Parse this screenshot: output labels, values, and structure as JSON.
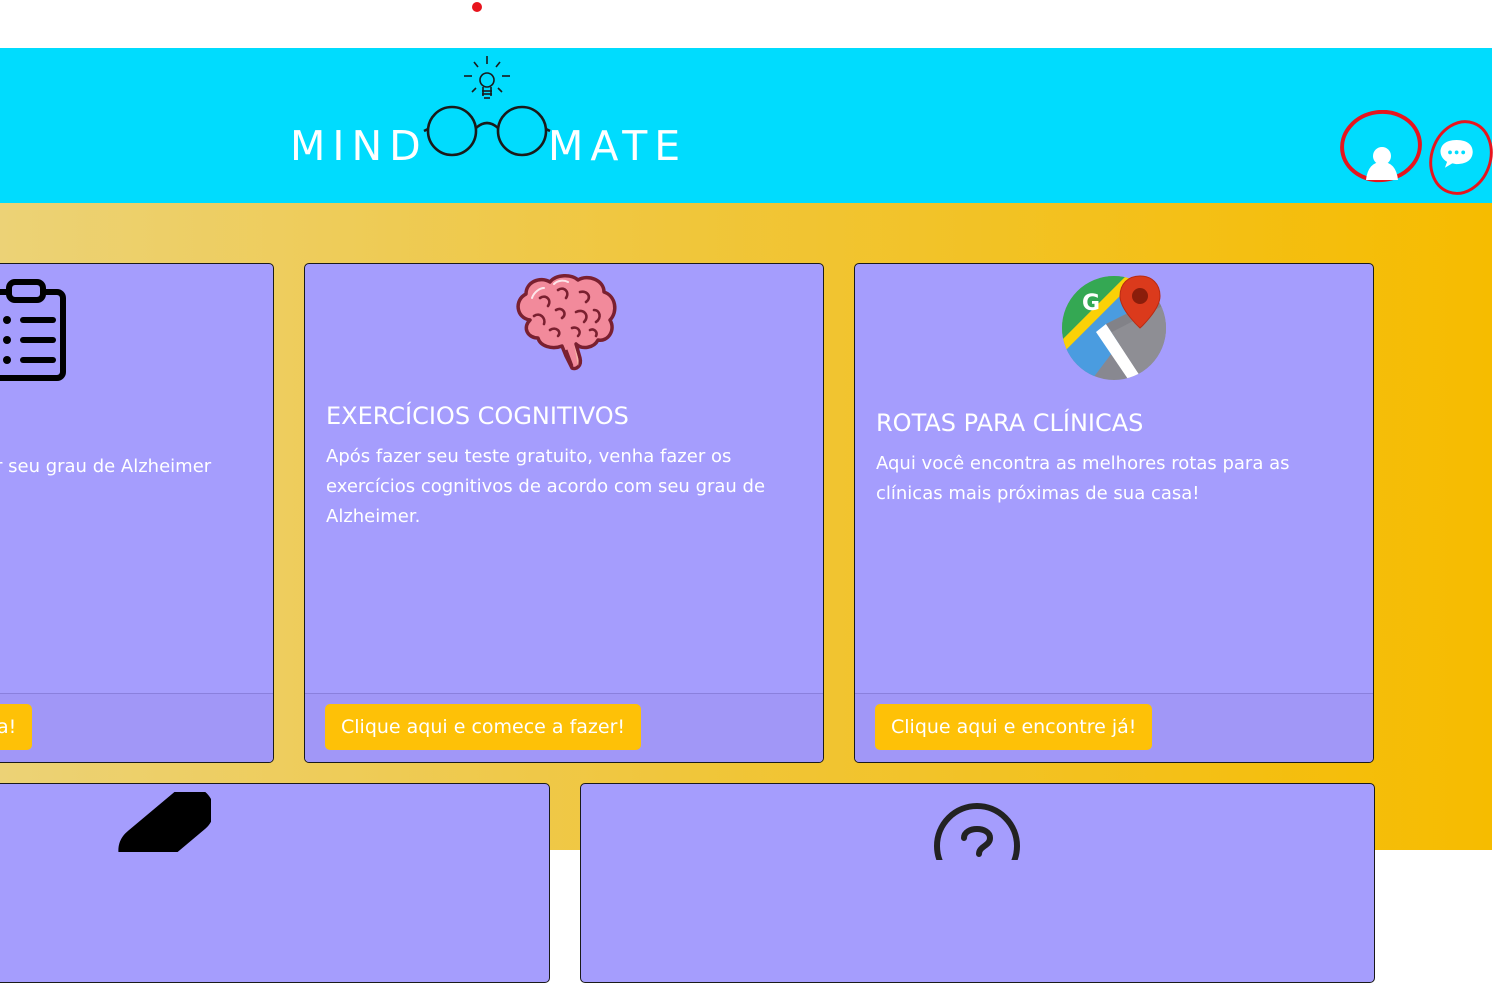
{
  "header": {
    "logo_left": "MIND",
    "logo_right": "MATE",
    "background": "#00dcfe",
    "user_icon": "user-icon",
    "chat_icon": "chat-bubble-icon"
  },
  "cards": [
    {
      "icon": "clipboard-list-icon",
      "text": "r seu grau de Alzheimer",
      "button": "a!"
    },
    {
      "icon": "brain-icon",
      "title": "EXERCÍCIOS COGNITIVOS",
      "text": "Após fazer seu teste gratuito, venha fazer os exercícios cognitivos de acordo com seu grau de Alzheimer.",
      "button": "Clique aqui e comece a fazer!"
    },
    {
      "icon": "google-maps-icon",
      "title": "ROTAS PARA CLÍNICAS",
      "text": "Aqui você encontra as melhores rotas para as clínicas mais próximas de sua casa!",
      "button": "Clique aqui e encontre já!"
    },
    {
      "icon": "pill-icon"
    },
    {
      "icon": "question-circle-icon"
    }
  ],
  "colors": {
    "card": "#a59dfd",
    "button": "#fec107",
    "annotation": "#e8141d"
  }
}
